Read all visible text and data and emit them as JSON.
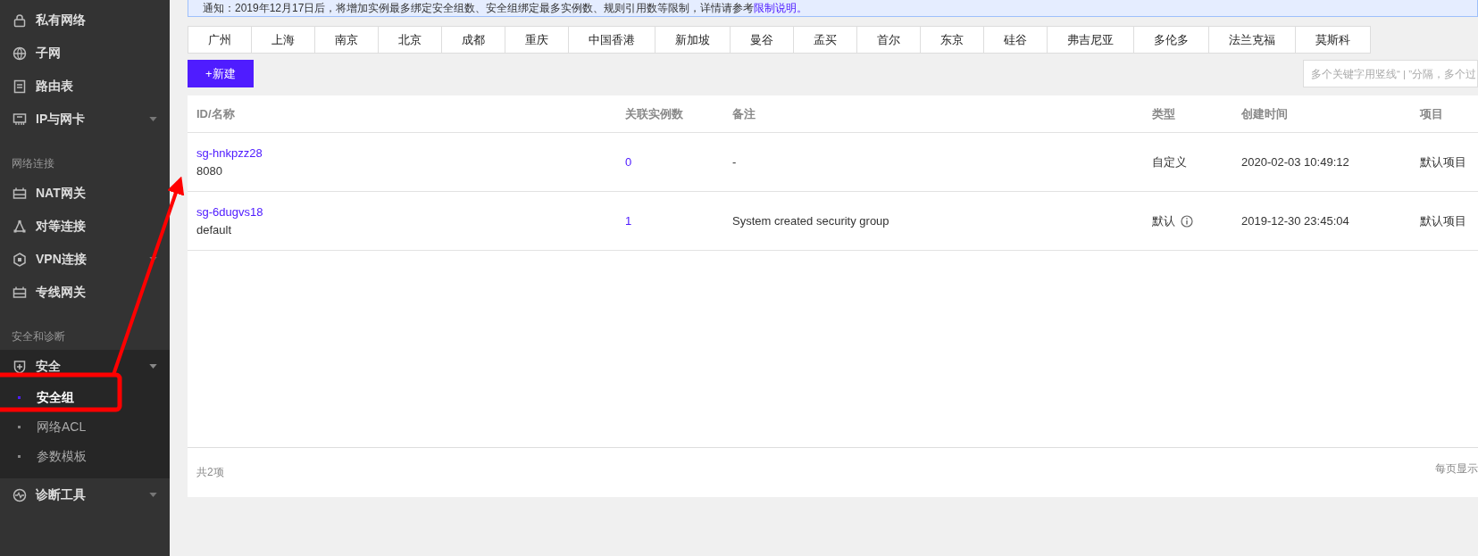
{
  "notice": {
    "text": "通知：2019年12月17日后，将增加实例最多绑定安全组数、安全组绑定最多实例数、规则引用数等限制，详情请参考",
    "link": "限制说明。"
  },
  "sidebar": {
    "items": [
      {
        "kind": "item",
        "label": "私有网络",
        "expandable": false,
        "expanded": false
      },
      {
        "kind": "item",
        "label": "子网",
        "expandable": false,
        "expanded": false
      },
      {
        "kind": "item",
        "label": "路由表",
        "expandable": false,
        "expanded": false
      },
      {
        "kind": "item",
        "label": "IP与网卡",
        "expandable": true,
        "expanded": false
      },
      {
        "kind": "section",
        "label": "网络连接"
      },
      {
        "kind": "item",
        "label": "NAT网关",
        "expandable": false,
        "expanded": false
      },
      {
        "kind": "item",
        "label": "对等连接",
        "expandable": false,
        "expanded": false
      },
      {
        "kind": "item",
        "label": "VPN连接",
        "expandable": true,
        "expanded": false
      },
      {
        "kind": "item",
        "label": "专线网关",
        "expandable": false,
        "expanded": false
      },
      {
        "kind": "section",
        "label": "安全和诊断"
      },
      {
        "kind": "item",
        "label": "安全",
        "expandable": true,
        "expanded": true,
        "children": [
          {
            "label": "安全组",
            "selected": true
          },
          {
            "label": "网络ACL",
            "selected": false
          },
          {
            "label": "参数模板",
            "selected": false
          }
        ]
      },
      {
        "kind": "item",
        "label": "诊断工具",
        "expandable": true,
        "expanded": false
      }
    ]
  },
  "regions": [
    {
      "label": "广州"
    },
    {
      "label": "上海"
    },
    {
      "label": "南京"
    },
    {
      "label": "北京"
    },
    {
      "label": "成都"
    },
    {
      "label": "重庆"
    },
    {
      "label": "中国香港"
    },
    {
      "label": "新加坡"
    },
    {
      "label": "曼谷"
    },
    {
      "label": "孟买"
    },
    {
      "label": "首尔"
    },
    {
      "label": "东京"
    },
    {
      "label": "硅谷"
    },
    {
      "label": "弗吉尼亚"
    },
    {
      "label": "多伦多"
    },
    {
      "label": "法兰克福"
    },
    {
      "label": "莫斯科"
    }
  ],
  "new_button": "+新建",
  "search": {
    "placeholder": "多个关键字用竖线“ | ”分隔，多个过"
  },
  "table": {
    "columns": [
      "ID/名称",
      "关联实例数",
      "备注",
      "类型",
      "创建时间",
      "项目"
    ],
    "rows": [
      {
        "id": "sg-hnkpzz28",
        "name": "8080",
        "instances": "0",
        "note": "-",
        "type": "自定义",
        "info": false,
        "created": "2020-02-03 10:49:12",
        "project": "默认项目"
      },
      {
        "id": "sg-6dugvs18",
        "name": "default",
        "instances": "1",
        "note": "System created security group",
        "type": "默认",
        "info": true,
        "created": "2019-12-30 23:45:04",
        "project": "默认项目"
      }
    ]
  },
  "footer": {
    "total": "共2项",
    "per_page": "每页显示"
  }
}
